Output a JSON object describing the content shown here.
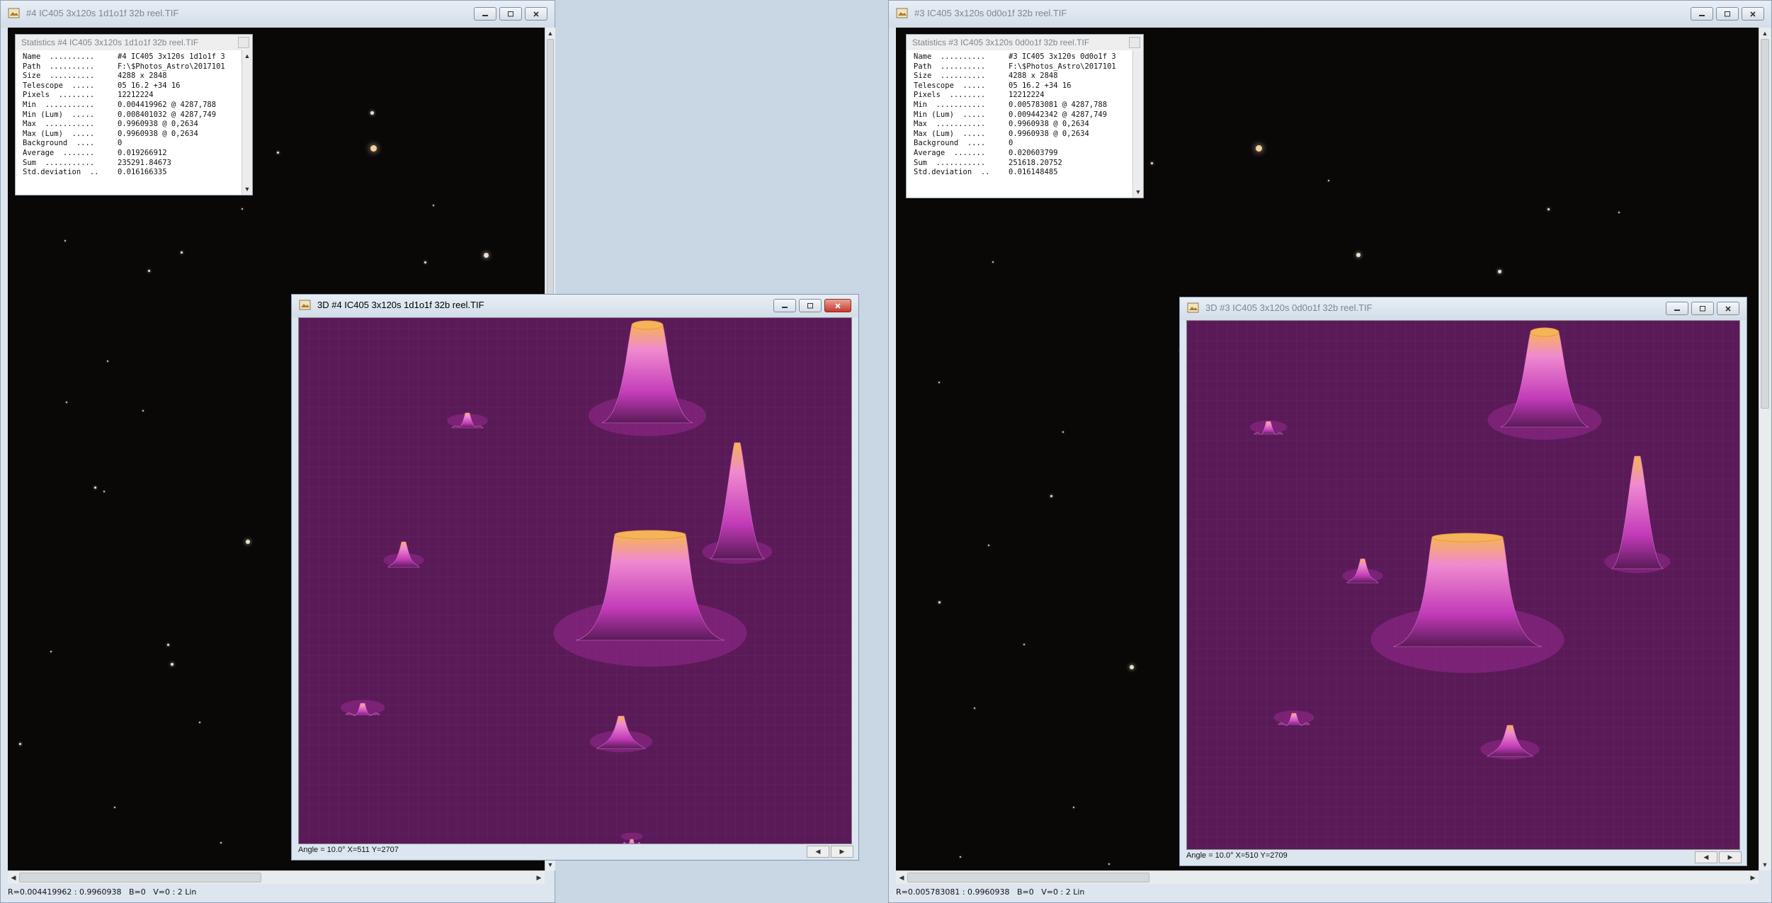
{
  "left_window": {
    "title": "#4 IC405 3x120s 1d1o1f 32b reel.TIF",
    "status": "R=0.004419962 : 0.9960938   B=0   V=0 : 2 Lin",
    "stats": {
      "title": "Statistics #4 IC405 3x120s 1d1o1f 32b reel.TIF",
      "rows": [
        {
          "key": "Name  ..........",
          "value": "#4 IC405 3x120s 1d1o1f 3"
        },
        {
          "key": "Path  ..........",
          "value": "F:\\$Photos_Astro\\2017101"
        },
        {
          "key": "Size  ..........",
          "value": "4288 x 2848"
        },
        {
          "key": "Telescope  .....",
          "value": "05 16.2  +34 16"
        },
        {
          "key": "Pixels  ........",
          "value": "12212224"
        },
        {
          "key": "Min  ...........",
          "value": "0.004419962 @ 4287,788"
        },
        {
          "key": "Min (Lum)  .....",
          "value": "0.008401032 @ 4287,749"
        },
        {
          "key": "Max  ...........",
          "value": "0.9960938 @ 0,2634"
        },
        {
          "key": "Max (Lum)  .....",
          "value": "0.9960938 @ 0,2634"
        },
        {
          "key": "Background  ....",
          "value": "0"
        },
        {
          "key": "Average  .......",
          "value": "0.019266912"
        },
        {
          "key": "Sum  ...........",
          "value": "235291.84673"
        },
        {
          "key": "Std.deviation  ..",
          "value": "0.016166335"
        }
      ]
    },
    "plot_window": {
      "title": "3D #4 IC405 3x120s 1d1o1f 32b reel.TIF",
      "status": "Angle = 10.0°  X=511  Y=2707"
    }
  },
  "right_window": {
    "title": "#3 IC405 3x120s 0d0o1f 32b reel.TIF",
    "status": "R=0.005783081 : 0.9960938   B=0   V=0 : 2 Lin",
    "stats": {
      "title": "Statistics #3 IC405 3x120s 0d0o1f 32b reel.TIF",
      "rows": [
        {
          "key": "Name  ..........",
          "value": "#3 IC405 3x120s 0d0o1f 3"
        },
        {
          "key": "Path  ..........",
          "value": "F:\\$Photos_Astro\\2017101"
        },
        {
          "key": "Size  ..........",
          "value": "4288 x 2848"
        },
        {
          "key": "Telescope  .....",
          "value": "05 16.2  +34 16"
        },
        {
          "key": "Pixels  ........",
          "value": "12212224"
        },
        {
          "key": "Min  ...........",
          "value": "0.005783081 @ 4287,788"
        },
        {
          "key": "Min (Lum)  .....",
          "value": "0.009442342 @ 4287,749"
        },
        {
          "key": "Max  ...........",
          "value": "0.9960938 @ 0,2634"
        },
        {
          "key": "Max (Lum)  .....",
          "value": "0.9960938 @ 0,2634"
        },
        {
          "key": "Background  ....",
          "value": "0"
        },
        {
          "key": "Average  .......",
          "value": "0.020603799"
        },
        {
          "key": "Sum  ...........",
          "value": "251618.20752"
        },
        {
          "key": "Std.deviation  ..",
          "value": "0.016148485"
        }
      ]
    },
    "plot_window": {
      "title": "3D #3 IC405 3x120s 0d0o1f 32b reel.TIF",
      "status": "Angle = 10.0°  X=510  Y=2709"
    }
  },
  "colors": {
    "sky": "#0a0707",
    "plot_floor": "#5a1a58",
    "peak_low": "#c83cc0",
    "peak_high": "#f8b04a",
    "titlebar": "#d8e2ec"
  },
  "icons": {
    "window_icon": "image-document-icon",
    "minimize": "minimize-icon",
    "maximize": "maximize-icon",
    "close": "close-icon",
    "scroll_left": "arrow-left-icon",
    "scroll_right": "arrow-right-icon",
    "scroll_up": "arrow-up-icon",
    "scroll_down": "arrow-down-icon"
  }
}
